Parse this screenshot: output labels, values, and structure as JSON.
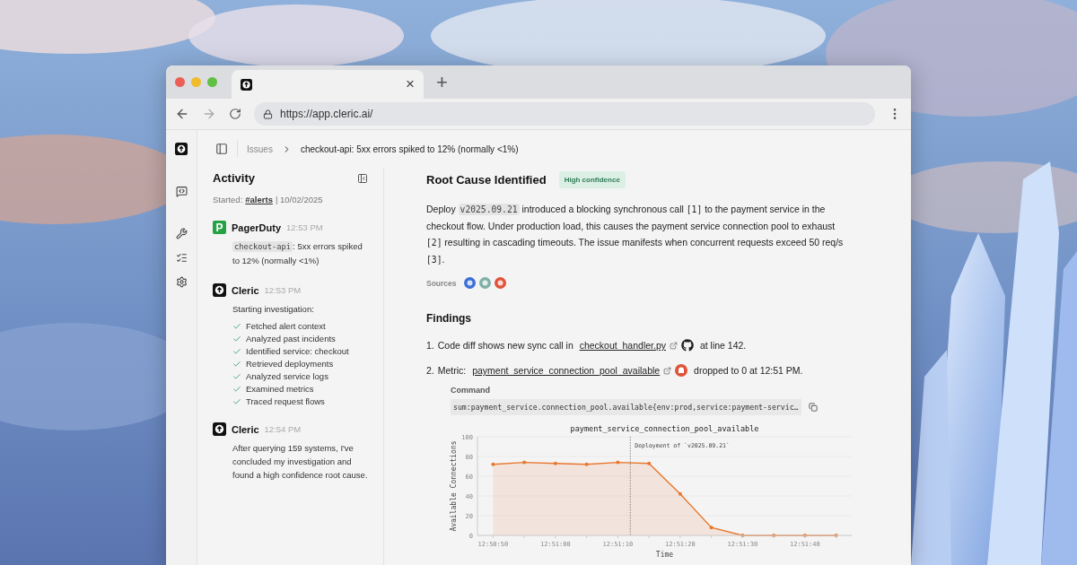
{
  "browser": {
    "tab": {
      "close": "×"
    },
    "new_tab": "+",
    "url": "https://app.cleric.ai/"
  },
  "breadcrumb": {
    "parent": "Issues",
    "current": "checkout-api: 5xx errors spiked to 12% (normally <1%)"
  },
  "activity": {
    "title": "Activity",
    "started_label": "Started:",
    "channel": "#alerts",
    "date": "| 10/02/2025",
    "events": [
      {
        "kind": "pagerduty",
        "avatar": "P",
        "name": "PagerDuty",
        "time": "12:53 PM",
        "code": "checkout-api",
        "text": ": 5xx errors spiked to 12% (normally <1%)"
      },
      {
        "kind": "cleric",
        "name": "Cleric",
        "time": "12:53 PM",
        "text": "Starting investigation:",
        "steps": [
          {
            "label": "Fetched alert context",
            "checked": true
          },
          {
            "label": "Analyzed past incidents",
            "checked": true
          },
          {
            "label": "Identified service: checkout",
            "checked": true
          },
          {
            "label": "Retrieved deployments",
            "checked": true
          },
          {
            "label": "Analyzed service logs",
            "checked": true
          },
          {
            "label": "Examined metrics",
            "checked": true
          },
          {
            "label": "Traced request flows",
            "checked": true
          }
        ]
      },
      {
        "kind": "cleric",
        "name": "Cleric",
        "time": "12:54 PM",
        "text": "After querying 159 systems, I've concluded my investigation and found a high confidence root cause."
      }
    ]
  },
  "root_cause": {
    "title": "Root Cause Identified",
    "badge": "High confidence",
    "paragraph": [
      {
        "kind": "text",
        "text": "Deploy "
      },
      {
        "kind": "code",
        "text": "v2025.09.21"
      },
      {
        "kind": "text",
        "text": " introduced a blocking synchronous call "
      },
      {
        "kind": "mono",
        "text": "[1]"
      },
      {
        "kind": "text",
        "text": " to the payment service in the checkout flow. Under production load, this causes the payment service connection pool to exhaust "
      },
      {
        "kind": "mono",
        "text": "[2]"
      },
      {
        "kind": "text",
        "text": " resulting in cascading timeouts. The issue manifests when concurrent requests exceed 50 req/s "
      },
      {
        "kind": "mono",
        "text": "[3]"
      },
      {
        "kind": "text",
        "text": "."
      }
    ],
    "sources_label": "Sources"
  },
  "findings": {
    "title": "Findings",
    "items": [
      {
        "number": "1.",
        "before": "Code diff shows new sync call in ",
        "link": "checkout_handler.py",
        "after": " at line 142."
      },
      {
        "number": "2.",
        "before": "Metric: ",
        "link": "payment_service_connection_pool_available",
        "after": " dropped to 0 at 12:51 PM."
      }
    ],
    "command_label": "Command",
    "command": "sum:payment_service.connection_pool.available{env:prod,service:payment-servic…",
    "chart_data": {
      "type": "area",
      "title": "payment_service_connection_pool_available",
      "xlabel": "Time",
      "ylabel": "Available Connections",
      "categories": [
        "12:50:50",
        null,
        "12:51:00",
        null,
        "12:51:10",
        null,
        "12:51:20",
        null,
        "12:51:30",
        null,
        "12:51:40",
        null
      ],
      "series": [
        {
          "color": "#e8772e",
          "values": [
            72,
            74,
            73,
            72,
            74,
            73,
            42,
            8,
            0,
            0,
            0,
            0
          ]
        }
      ],
      "ylim": [
        0,
        100
      ],
      "yticks": [
        0,
        20,
        40,
        60,
        80,
        100
      ],
      "annotations": [
        "Deployment of `v2025.09.21`"
      ]
    }
  }
}
